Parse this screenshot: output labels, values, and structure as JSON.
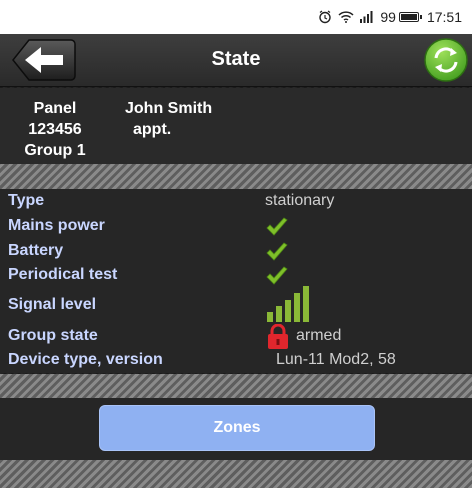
{
  "status_bar": {
    "battery_text": "99",
    "time": "17:51",
    "icons": [
      "alarm-clock-icon",
      "wifi-icon",
      "signal-icon",
      "battery-icon"
    ]
  },
  "header": {
    "title": "State",
    "back_icon": "arrow-left-icon",
    "refresh_icon": "refresh-icon"
  },
  "panel": {
    "label": "Panel",
    "number": "123456",
    "group": "Group 1",
    "owner_name": "John Smith",
    "owner_unit": "appt."
  },
  "info": {
    "type": {
      "label": "Type",
      "value": "stationary"
    },
    "mains_power": {
      "label": "Mains power",
      "status_icon": "check-icon"
    },
    "battery": {
      "label": "Battery",
      "status_icon": "check-icon"
    },
    "periodical_test": {
      "label": "Periodical test",
      "status_icon": "check-icon"
    },
    "signal_level": {
      "label": "Signal level",
      "bars": 5,
      "max_bars": 5
    },
    "group_state": {
      "label": "Group state",
      "value": "armed",
      "status_icon": "lock-icon"
    },
    "device": {
      "label": "Device type, version",
      "value": "Lun-11 Mod2, 58"
    }
  },
  "zones_button": {
    "label": "Zones"
  },
  "colors": {
    "label_text": "#c9d6ff",
    "check_green": "#7fbf2a",
    "signal_green": "#8ab837",
    "lock_red": "#e1262d",
    "button_blue": "#8fb1f2"
  }
}
